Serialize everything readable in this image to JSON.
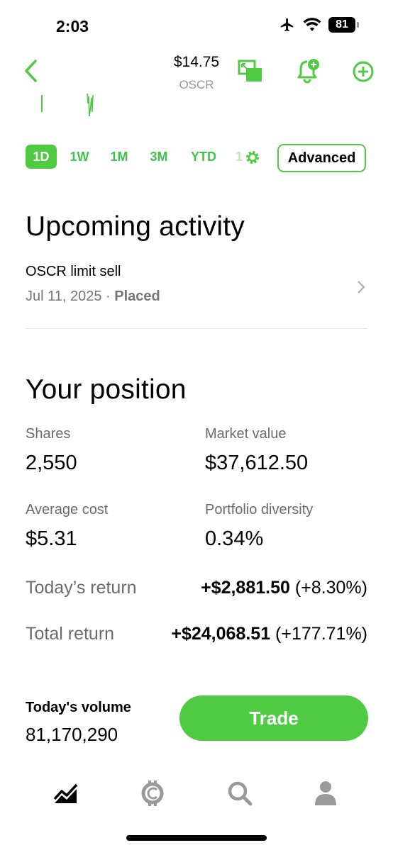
{
  "status_bar": {
    "time": "2:03",
    "battery": "81"
  },
  "header": {
    "price": "$14.75",
    "ticker": "OSCR"
  },
  "ranges": {
    "tabs": [
      "1D",
      "1W",
      "1M",
      "3M",
      "YTD",
      "1"
    ],
    "active": "1D",
    "advanced_label": "Advanced"
  },
  "upcoming": {
    "title": "Upcoming activity",
    "item": {
      "title": "OSCR limit sell",
      "date": "Jul 11, 2025",
      "separator": " · ",
      "status": "Placed"
    }
  },
  "position": {
    "title": "Your position",
    "shares_label": "Shares",
    "shares_value": "2,550",
    "market_value_label": "Market value",
    "market_value": "$37,612.50",
    "avg_cost_label": "Average cost",
    "avg_cost_value": "$5.31",
    "diversity_label": "Portfolio diversity",
    "diversity_value": "0.34%",
    "todays_return_label": "Today’s return",
    "todays_return_amount": "+$2,881.50",
    "todays_return_pct": " (+8.30%)",
    "total_return_label": "Total return",
    "total_return_amount": "+$24,068.51",
    "total_return_pct": " (+177.71%)"
  },
  "volume": {
    "label": "Today's volume",
    "value": "81,170,290"
  },
  "trade_button": "Trade",
  "nav": [
    "chart-icon",
    "crypto-icon",
    "search-icon",
    "account-icon"
  ],
  "colors": {
    "accent": "#4fcb43",
    "muted": "#6b6b6b"
  }
}
